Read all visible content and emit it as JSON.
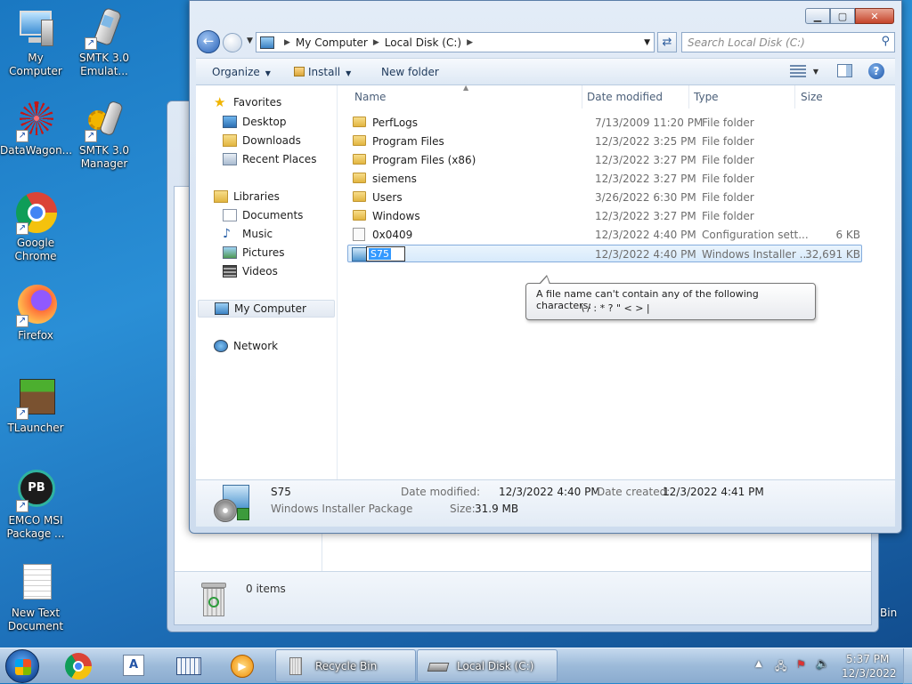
{
  "desktop": {
    "icons": [
      {
        "label": "My Computer"
      },
      {
        "label": "SMTK 3.0 Emulat..."
      },
      {
        "label": "DataWagon..."
      },
      {
        "label": "SMTK 3.0 Manager"
      },
      {
        "label": "Google Chrome"
      },
      {
        "label": "Firefox"
      },
      {
        "label": "TLauncher"
      },
      {
        "label": "EMCO MSI Package ..."
      },
      {
        "label": "New Text Document"
      }
    ],
    "partial_icon_label": "Bin"
  },
  "background_window": {
    "status_items": "0 items"
  },
  "window": {
    "address": {
      "segments": [
        "My Computer",
        "Local Disk (C:)"
      ]
    },
    "search_placeholder": "Search Local Disk (C:)",
    "toolbar": {
      "organize": "Organize",
      "install": "Install",
      "new_folder": "New folder"
    },
    "nav": {
      "favorites": "Favorites",
      "desktop": "Desktop",
      "downloads": "Downloads",
      "recent_places": "Recent Places",
      "libraries": "Libraries",
      "documents": "Documents",
      "music": "Music",
      "pictures": "Pictures",
      "videos": "Videos",
      "my_computer": "My Computer",
      "network": "Network"
    },
    "columns": {
      "name": "Name",
      "date_modified": "Date modified",
      "type": "Type",
      "size": "Size"
    },
    "files": [
      {
        "name": "PerfLogs",
        "date": "7/13/2009 11:20 PM",
        "type": "File folder",
        "size": ""
      },
      {
        "name": "Program Files",
        "date": "12/3/2022 3:25 PM",
        "type": "File folder",
        "size": ""
      },
      {
        "name": "Program Files (x86)",
        "date": "12/3/2022 3:27 PM",
        "type": "File folder",
        "size": ""
      },
      {
        "name": "siemens",
        "date": "12/3/2022 3:27 PM",
        "type": "File folder",
        "size": ""
      },
      {
        "name": "Users",
        "date": "3/26/2022 6:30 PM",
        "type": "File folder",
        "size": ""
      },
      {
        "name": "Windows",
        "date": "12/3/2022 3:27 PM",
        "type": "File folder",
        "size": ""
      },
      {
        "name": "0x0409",
        "date": "12/3/2022 4:40 PM",
        "type": "Configuration sett...",
        "size": "6 KB"
      },
      {
        "name": "S75",
        "date": "12/3/2022 4:40 PM",
        "type": "Windows Installer ...",
        "size": "32,691 KB"
      }
    ],
    "rename_value": "S75",
    "tooltip": {
      "line1": "A file name can't contain any of the following characters:",
      "line2": "\\ / : * ? \" < > |"
    },
    "details": {
      "name": "S75",
      "kind": "Windows Installer Package",
      "date_modified_label": "Date modified:",
      "date_modified": "12/3/2022 4:40 PM",
      "date_created_label": "Date created:",
      "date_created": "12/3/2022 4:41 PM",
      "size_label": "Size:",
      "size": "31.9 MB"
    }
  },
  "taskbar": {
    "tasks": [
      {
        "label": "Recycle Bin"
      },
      {
        "label": "Local Disk (C:)"
      }
    ],
    "clock_time": "5:37 PM",
    "clock_date": "12/3/2022"
  }
}
